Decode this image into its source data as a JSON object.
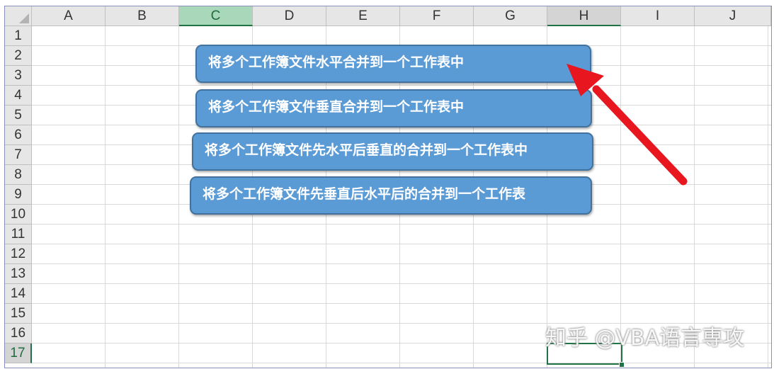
{
  "columns": [
    "A",
    "B",
    "C",
    "D",
    "E",
    "F",
    "G",
    "H",
    "I",
    "J"
  ],
  "active_column": "C",
  "rows": [
    "1",
    "2",
    "3",
    "4",
    "5",
    "6",
    "7",
    "8",
    "9",
    "10",
    "11",
    "12",
    "13",
    "14",
    "15",
    "16",
    "17"
  ],
  "buttons": [
    {
      "label": "将多个工作簿文件水平合并到一个工作表中"
    },
    {
      "label": "将多个工作簿文件垂直合并到一个工作表中"
    },
    {
      "label": "将多个工作簿文件先水平后垂直的合并到一个工作表中"
    },
    {
      "label": "将多个工作簿文件先垂直后水平后的合并到一个工作表"
    }
  ],
  "selected_cell": "H17",
  "colors": {
    "button_fill": "#5b9bd5",
    "button_border": "#41719c",
    "arrow": "#e8161e",
    "selection": "#217346"
  },
  "watermark": "知乎 @VBA语言専攻",
  "annotation_icon": "red-arrow-icon"
}
